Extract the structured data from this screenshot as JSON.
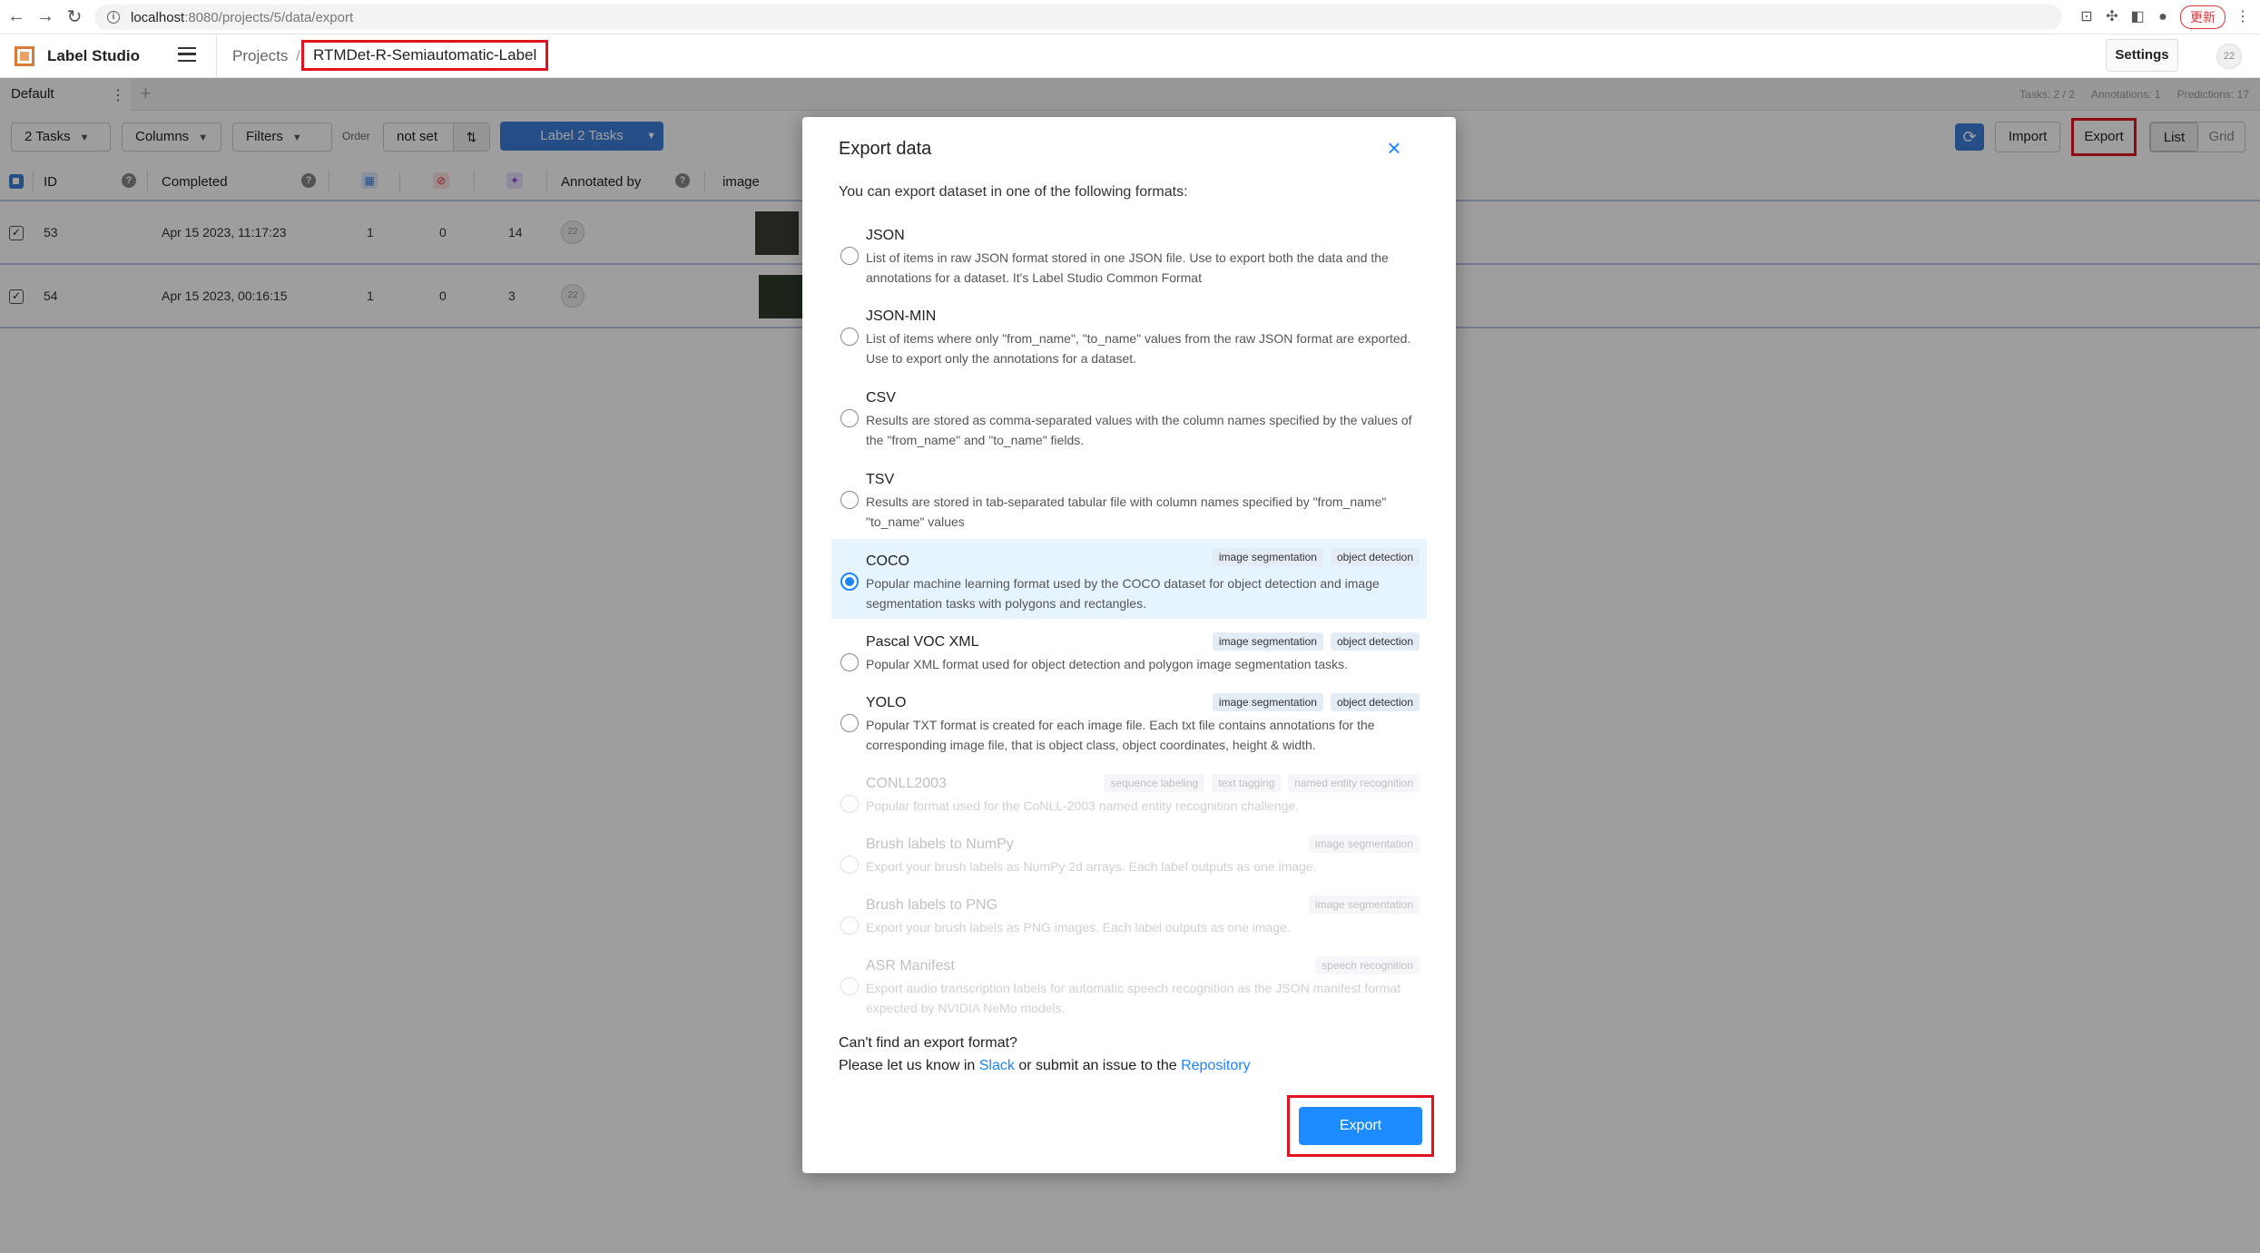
{
  "browser": {
    "url_host": "localhost",
    "url_path": ":8080/projects/5/data/export",
    "update_label": "更新"
  },
  "header": {
    "app_name": "Label Studio",
    "breadcrumb_projects": "Projects",
    "breadcrumb_sep": "/",
    "project_name": "RTMDet-R-Semiautomatic-Label",
    "settings_label": "Settings",
    "avatar_initials": "22"
  },
  "tabs": {
    "current": "Default",
    "menu": "⋮",
    "add": "+"
  },
  "stats": {
    "tasks": "Tasks: 2 / 2",
    "annotations": "Annotations: 1",
    "predictions": "Predictions: 17"
  },
  "toolbar": {
    "tasks_btn": "2 Tasks",
    "columns_btn": "Columns",
    "filters_btn": "Filters",
    "order_label": "Order",
    "order_value": "not set",
    "label_btn": "Label 2 Tasks",
    "import_btn": "Import",
    "export_btn": "Export",
    "view_list": "List",
    "view_grid": "Grid"
  },
  "table": {
    "headers": {
      "id": "ID",
      "completed": "Completed",
      "annotated_by": "Annotated by",
      "image": "image"
    },
    "rows": [
      {
        "id": "53",
        "completed": "Apr 15 2023, 11:17:23",
        "total": "1",
        "cancelled": "0",
        "predictions": "14",
        "avatar": "22"
      },
      {
        "id": "54",
        "completed": "Apr 15 2023, 00:16:15",
        "total": "1",
        "cancelled": "0",
        "predictions": "3",
        "avatar": "22"
      }
    ]
  },
  "modal": {
    "title": "Export data",
    "close": "×",
    "description": "You can export dataset in one of the following formats:",
    "formats": [
      {
        "name": "JSON",
        "desc": "List of items in raw JSON format stored in one JSON file. Use to export both the data and the annotations for a dataset. It's Label Studio Common Format",
        "tags": []
      },
      {
        "name": "JSON-MIN",
        "desc": "List of items where only \"from_name\", \"to_name\" values from the raw JSON format are exported. Use to export only the annotations for a dataset.",
        "tags": []
      },
      {
        "name": "CSV",
        "desc": "Results are stored as comma-separated values with the column names specified by the values of the \"from_name\" and \"to_name\" fields.",
        "tags": []
      },
      {
        "name": "TSV",
        "desc": "Results are stored in tab-separated tabular file with column names specified by \"from_name\" \"to_name\" values",
        "tags": []
      },
      {
        "name": "COCO",
        "desc": "Popular machine learning format used by the COCO dataset for object detection and image segmentation tasks with polygons and rectangles.",
        "tags": [
          "image segmentation",
          "object detection"
        ]
      },
      {
        "name": "Pascal VOC XML",
        "desc": "Popular XML format used for object detection and polygon image segmentation tasks.",
        "tags": [
          "image segmentation",
          "object detection"
        ]
      },
      {
        "name": "YOLO",
        "desc": "Popular TXT format is created for each image file. Each txt file contains annotations for the corresponding image file, that is object class, object coordinates, height & width.",
        "tags": [
          "image segmentation",
          "object detection"
        ]
      },
      {
        "name": "CONLL2003",
        "desc": "Popular format used for the CoNLL-2003 named entity recognition challenge.",
        "tags": [
          "sequence labeling",
          "text tagging",
          "named entity recognition"
        ]
      },
      {
        "name": "Brush labels to NumPy",
        "desc": "Export your brush labels as NumPy 2d arrays. Each label outputs as one image.",
        "tags": [
          "image segmentation"
        ]
      },
      {
        "name": "Brush labels to PNG",
        "desc": "Export your brush labels as PNG images. Each label outputs as one image.",
        "tags": [
          "image segmentation"
        ]
      },
      {
        "name": "ASR Manifest",
        "desc": "Export audio transcription labels for automatic speech recognition as the JSON manifest format expected by NVIDIA NeMo models.",
        "tags": [
          "speech recognition"
        ]
      }
    ],
    "help_line1": "Can't find an export format?",
    "help_prefix": "Please let us know in ",
    "help_slack": "Slack",
    "help_middle": " or submit an issue to the ",
    "help_repo": "Repository",
    "export_button": "Export"
  }
}
